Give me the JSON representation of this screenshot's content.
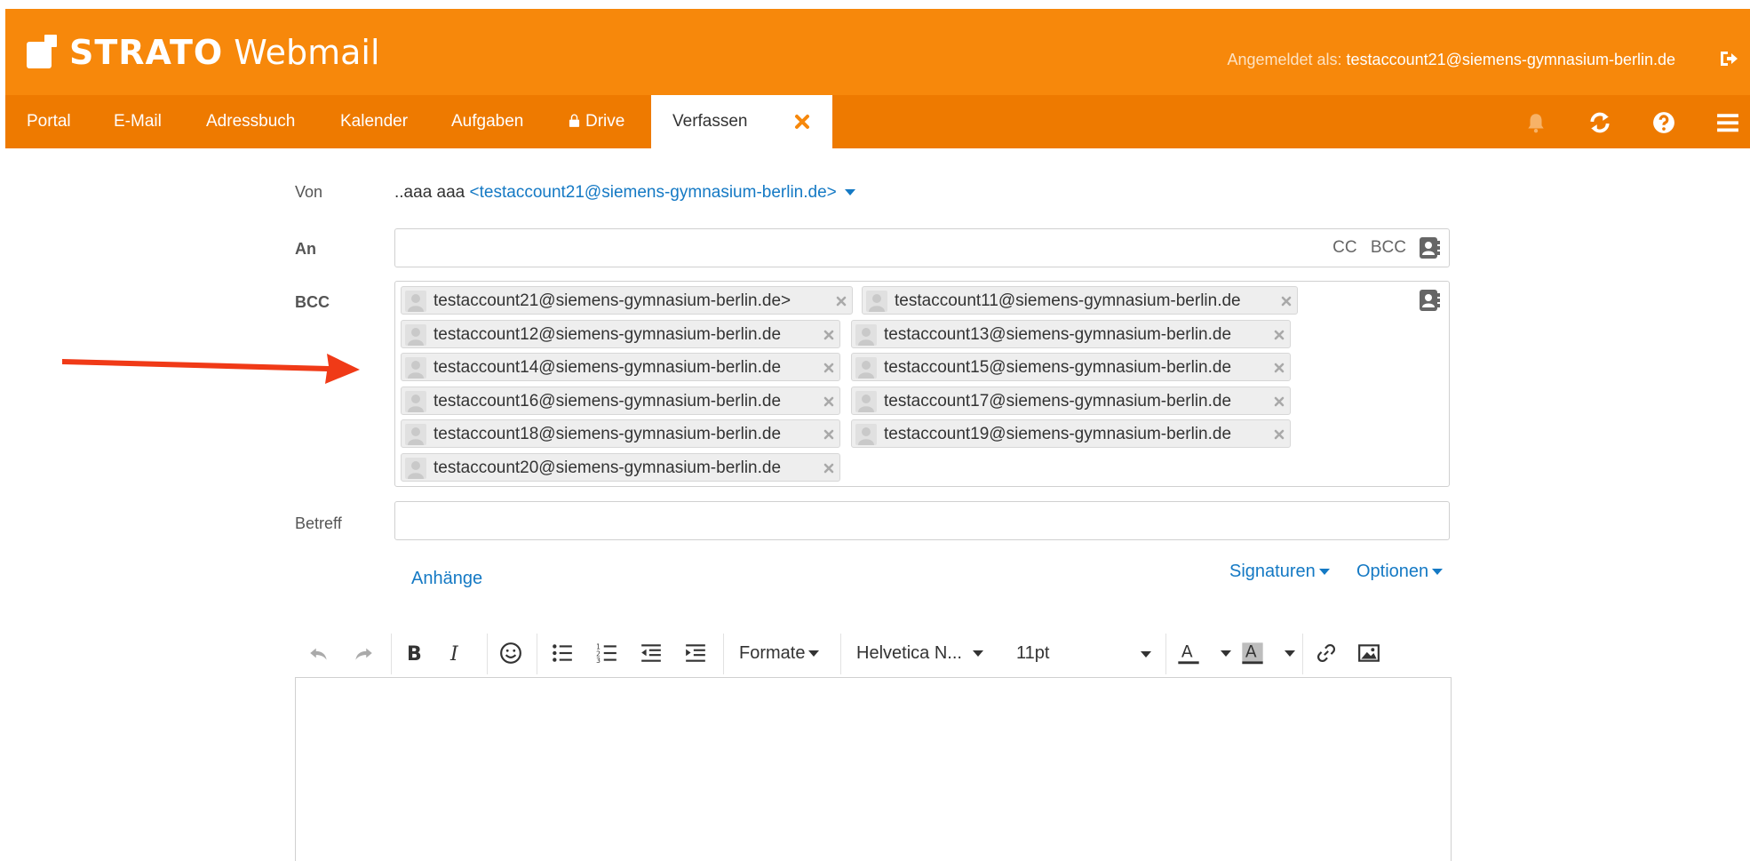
{
  "brand": {
    "name": "STRATO",
    "product": "Webmail"
  },
  "header": {
    "signed_in_label": "Angemeldet als:",
    "signed_in_user": "testaccount21@siemens-gymnasium-berlin.de"
  },
  "nav": {
    "items": [
      "Portal",
      "E-Mail",
      "Adressbuch",
      "Kalender",
      "Aufgaben",
      "Drive"
    ],
    "active": "Verfassen"
  },
  "compose": {
    "from_label": "Von",
    "from_name": "..aaa aaa",
    "from_address": "<testaccount21@siemens-gymnasium-berlin.de>",
    "to_label": "An",
    "cc_label": "CC",
    "bcc_label": "BCC",
    "bcc_field_label": "BCC",
    "bcc_recipients": [
      "testaccount21@siemens-gymnasium-berlin.de>",
      "testaccount11@siemens-gymnasium-berlin.de",
      "testaccount12@siemens-gymnasium-berlin.de",
      "testaccount13@siemens-gymnasium-berlin.de",
      "testaccount14@siemens-gymnasium-berlin.de",
      "testaccount15@siemens-gymnasium-berlin.de",
      "testaccount16@siemens-gymnasium-berlin.de",
      "testaccount17@siemens-gymnasium-berlin.de",
      "testaccount18@siemens-gymnasium-berlin.de",
      "testaccount19@siemens-gymnasium-berlin.de",
      "testaccount20@siemens-gymnasium-berlin.de"
    ],
    "subject_label": "Betreff",
    "subject_value": "",
    "attachments_link": "Anhänge",
    "signatures_link": "Signaturen",
    "options_link": "Optionen"
  },
  "editor_toolbar": {
    "formats_label": "Formate",
    "font_family": "Helvetica N...",
    "font_size": "11pt"
  },
  "colors": {
    "header_orange": "#f7880b",
    "nav_orange": "#ee7a00",
    "link_blue": "#1479c4",
    "annotation_arrow": "#f03a17"
  }
}
